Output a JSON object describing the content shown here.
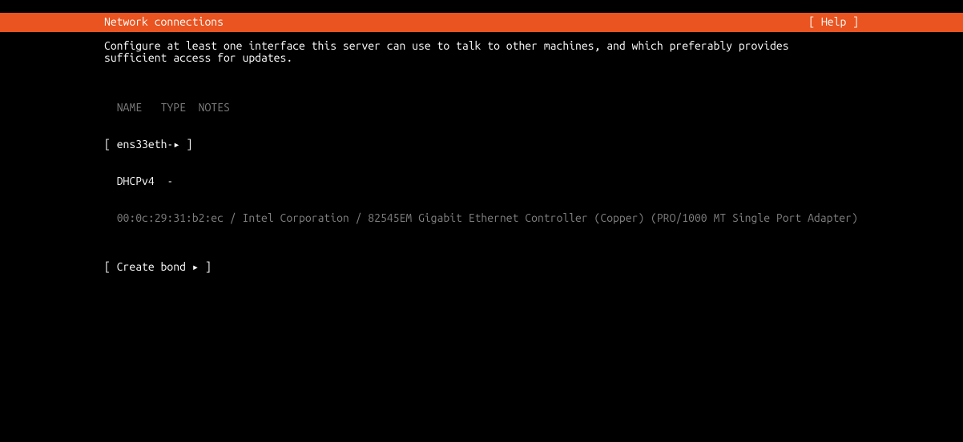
{
  "header": {
    "title": "Network connections",
    "help": "[ Help ]"
  },
  "description": "Configure at least one interface this server can use to talk to other machines, and which preferably provides sufficient access for updates.",
  "table": {
    "headers": {
      "name": "NAME",
      "type": "TYPE",
      "notes": "NOTES"
    },
    "interface": {
      "bracket_open": "[ ",
      "name": "ens33",
      "type": "eth",
      "notes": "-",
      "arrow": "▸",
      "bracket_close": " ]"
    },
    "dhcp": {
      "label": "DHCPv4",
      "value": "-"
    },
    "hardware_info": "00:0c:29:31:b2:ec / Intel Corporation / 82545EM Gigabit Ethernet Controller (Copper) (PRO/1000 MT Single Port Adapter)"
  },
  "actions": {
    "create_bond": "[ Create bond ▸ ]"
  }
}
